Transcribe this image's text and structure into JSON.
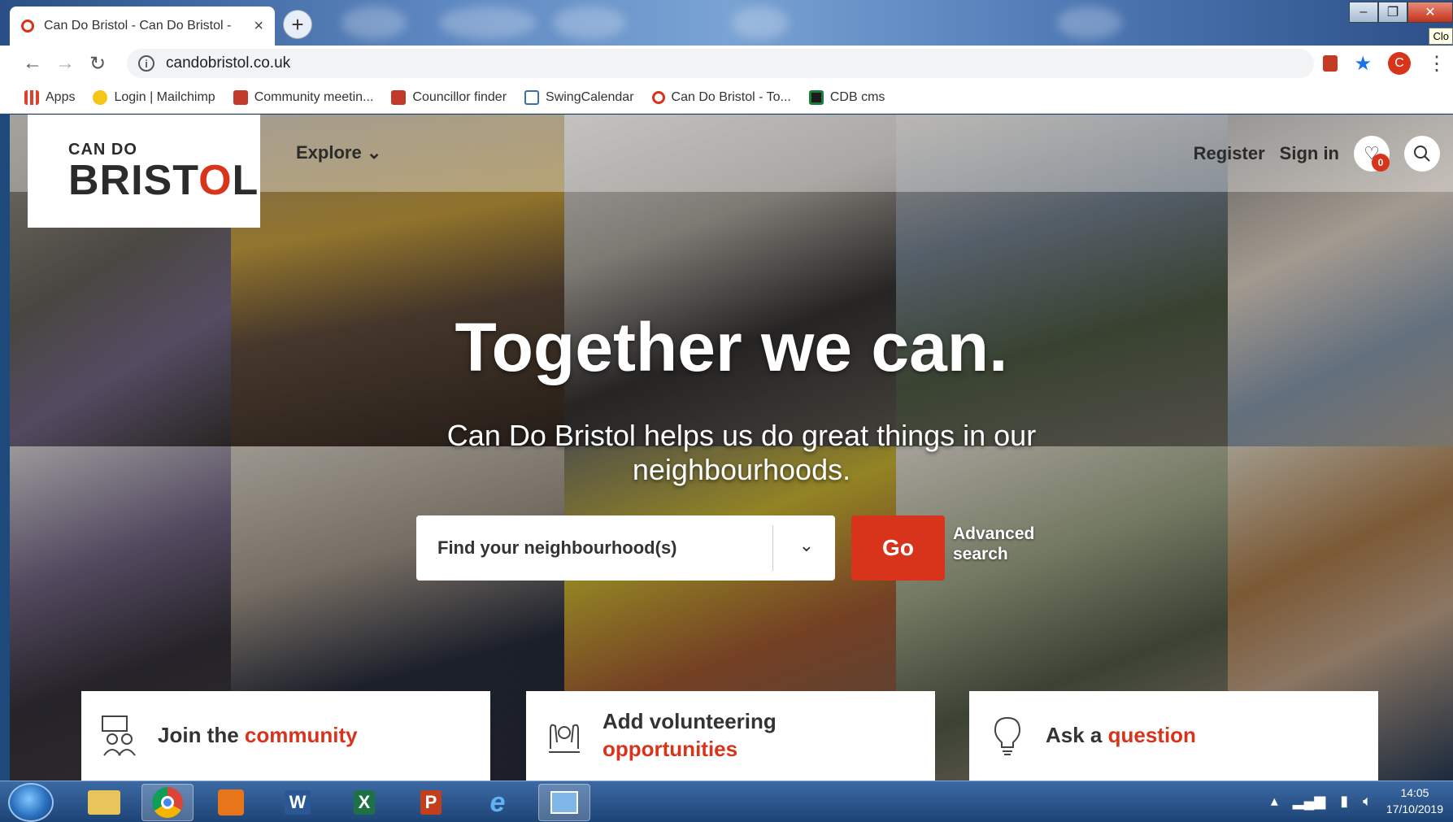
{
  "browser": {
    "tab_title": "Can Do Bristol - Can Do Bristol - ",
    "tab_close": "×",
    "new_tab": "+",
    "url": "candobristol.co.uk",
    "tooltip": "Clo",
    "profile_initial": "C",
    "window_controls": [
      "–",
      "❐",
      "✕"
    ],
    "bookmarks": [
      {
        "label": "Apps",
        "icon": "apps-grid-icon",
        "color": "#e04030"
      },
      {
        "label": "Login | Mailchimp",
        "icon": "mailchimp-icon",
        "color": "#f5c518"
      },
      {
        "label": "Community meetin...",
        "icon": "council-icon",
        "color": "#c0392b"
      },
      {
        "label": "Councillor finder",
        "icon": "council-icon",
        "color": "#c0392b"
      },
      {
        "label": "SwingCalendar",
        "icon": "calendar-icon",
        "color": "#3a6fb0"
      },
      {
        "label": "Can Do Bristol - To...",
        "icon": "candobristol-icon",
        "color": "#d8341c"
      },
      {
        "label": "CDB cms",
        "icon": "cms-icon",
        "color": "#1b7b3a"
      }
    ]
  },
  "header": {
    "logo_top": "CAN DO",
    "logo_main_before": "BRIST",
    "logo_main_o": "O",
    "logo_main_after": "L",
    "explore": "Explore",
    "explore_chevron": "⌄",
    "register": "Register",
    "sign_in": "Sign in",
    "favourites_count": "0"
  },
  "hero": {
    "title": "Together we can.",
    "subtitle": "Can Do Bristol helps us do great things in our neighbourhoods.",
    "search_placeholder": "Find your neighbourhood(s)",
    "search_chevron": "⌄",
    "go_label": "Go",
    "advanced_search": "Advanced search"
  },
  "cards": [
    {
      "lead": "Join the ",
      "accent": "community",
      "icon": "community-icon"
    },
    {
      "lead": "Add volunteering ",
      "accent": "opportunities",
      "icon": "volunteering-icon"
    },
    {
      "lead": "Ask a ",
      "accent": "question",
      "icon": "lightbulb-icon"
    }
  ],
  "taskbar": {
    "apps": [
      "explorer-icon",
      "chrome-icon",
      "media-player-icon",
      "word-icon",
      "excel-icon",
      "powerpoint-icon",
      "internet-explorer-icon",
      "remote-desktop-icon"
    ],
    "time": "14:05",
    "date": "17/10/2019"
  },
  "colors": {
    "brand_red": "#d8341c",
    "text_dark": "#2b2b2b",
    "taskbar_blue": "#1d4476"
  }
}
